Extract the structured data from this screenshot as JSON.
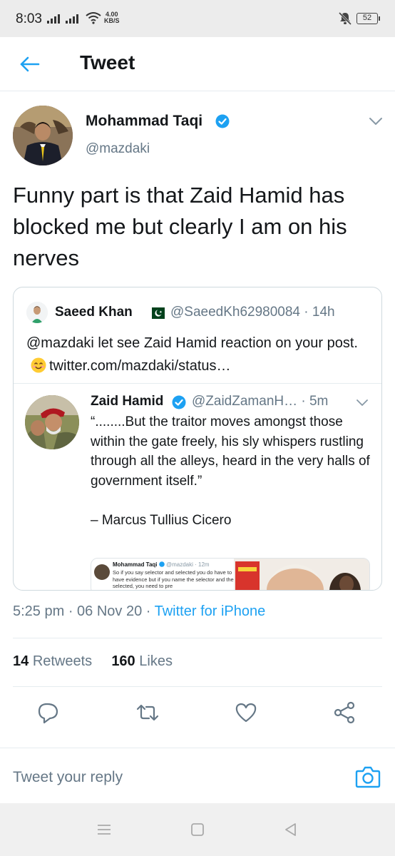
{
  "status_bar": {
    "time": "8:03",
    "net_speed_value": "4.00",
    "net_speed_unit": "KB/S",
    "battery": "52"
  },
  "header": {
    "title": "Tweet"
  },
  "tweet": {
    "author_name": "Mohammad Taqi",
    "author_handle": "@mazdaki",
    "text": "Funny part is that Zaid Hamid has blocked me but clearly I am on his nerves",
    "timestamp": "5:25 pm · 06 Nov 20 · ",
    "source": "Twitter for iPhone",
    "retweets_count": "14",
    "retweets_label": "Retweets",
    "likes_count": "160",
    "likes_label": "Likes"
  },
  "quoted": {
    "author_name": "Saeed Khan",
    "handle_time": "@SaeedKh62980084 · 14h",
    "text_before": "@mazdaki let see Zaid Hamid reaction on your post.",
    "text_link": "twitter.com/mazdaki/status…",
    "nested": {
      "author_name": "Zaid Hamid",
      "handle_time": "@ZaidZamanH… · 5m",
      "text": "“........But the traitor moves amongst those within the gate freely, his sly whispers rustling through all the alleys, heard in the very halls of government itself.”\n\n– Marcus Tullius Cicero",
      "screenshot": {
        "name": "Mohammad Taqi",
        "handle_time": "@mazdaki · 12m",
        "body": "So if you say selector and selected you do have to have evidence but if you name the selector and the selected, you need to pre"
      }
    }
  },
  "reply": {
    "placeholder": "Tweet your reply"
  },
  "colors": {
    "accent": "#1da1f2",
    "secondary_text": "#657786",
    "primary_text": "#14171a",
    "divider": "#e6ecf0"
  },
  "icons": {
    "back": "arrow-left-icon",
    "verified": "verified-badge-icon",
    "caret": "chevron-down-icon",
    "reply": "comment-icon",
    "retweet": "retweet-icon",
    "like": "heart-icon",
    "share": "share-icon",
    "camera": "camera-icon"
  }
}
